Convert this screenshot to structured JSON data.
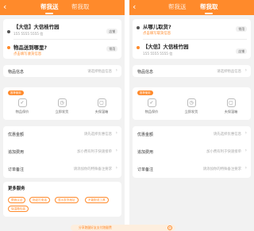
{
  "colors": {
    "accent": "#ff8a2b",
    "bg": "#f2f2f2",
    "card": "#ffffff"
  },
  "tabs": {
    "left": "帮我送",
    "right": "帮我取"
  },
  "left_panel": {
    "from": {
      "name": "【大信】大信桂竹园",
      "phone": "155 5555 5555 信",
      "tag": "店铺"
    },
    "to": {
      "name": "物品送到哪里?",
      "hint": "点击填写收货信息",
      "tag": "常用"
    }
  },
  "right_panel": {
    "from": {
      "name": "从哪儿取货?",
      "hint": "点击填写取货信息",
      "tag": "常用"
    },
    "to": {
      "name": "【大信】大信桂竹园",
      "phone": "155 5555 5555 信",
      "tag": "店铺"
    }
  },
  "goods": {
    "label": "物品信息",
    "placeholder": "请选择物品信息"
  },
  "services": {
    "badge": "推荐使用",
    "items": [
      {
        "label": "物品保价",
        "icon": "shield-icon",
        "glyph": "✓"
      },
      {
        "label": "立即发货",
        "icon": "clock-icon",
        "glyph": "◷"
      },
      {
        "label": "夫保温箱",
        "icon": "box-icon",
        "glyph": "▢"
      }
    ]
  },
  "coupon": {
    "label": "优惠金额",
    "value": "请先选择优惠信息"
  },
  "extra_fee": {
    "label": "追加费用",
    "value": "加小费有利于快速接单"
  },
  "order_note": {
    "label": "订单备注",
    "value": "请添加你的特殊备注要求"
  },
  "more": {
    "title": "更多服务",
    "chips": [
      "帮我认证",
      "指定打电话",
      "显示发货地址",
      "不能配送工具",
      "保温箱包装"
    ]
  },
  "footer": {
    "text": "分享跑腿好友支付跑腿费",
    "close_glyph": "×"
  },
  "icons": {
    "back": "‹",
    "chevron": "›"
  }
}
